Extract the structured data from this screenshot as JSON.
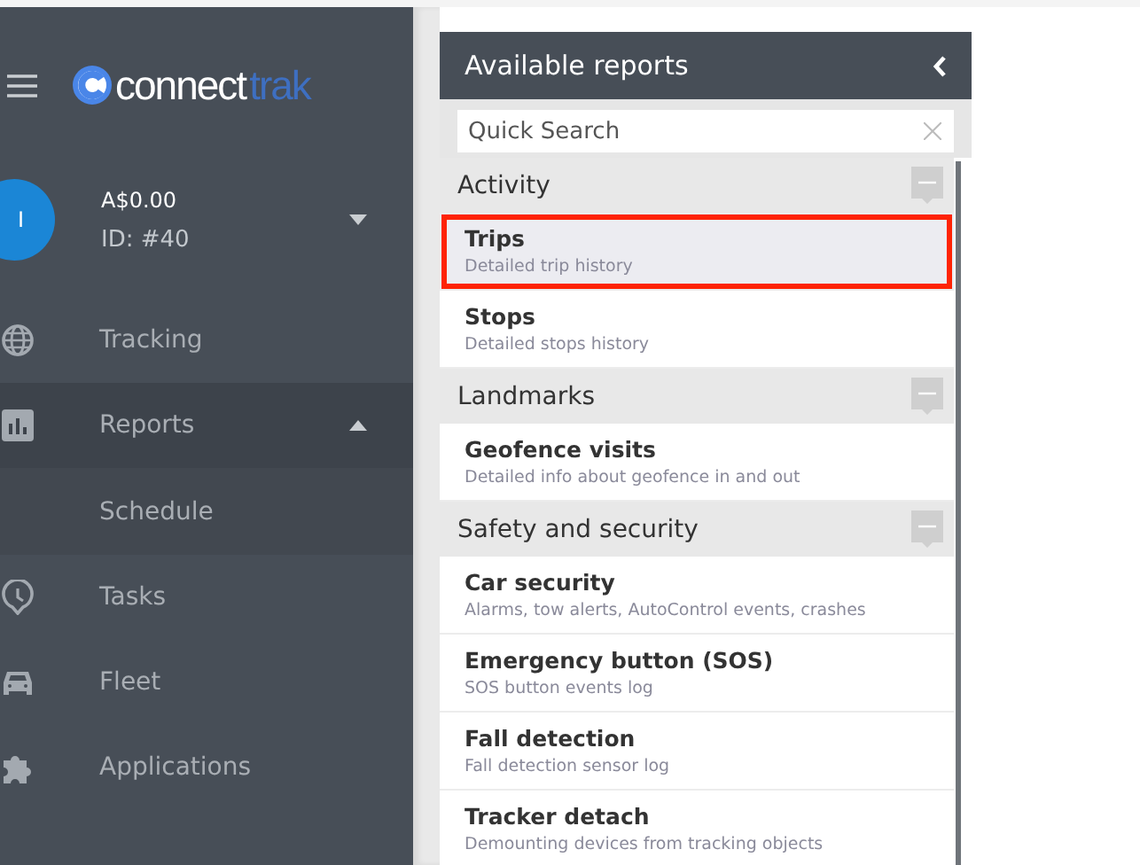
{
  "sidebar": {
    "logo": {
      "main": "connect",
      "accent": "trak"
    },
    "account": {
      "avatar_letter": "I",
      "balance": "A$0.00",
      "id": "ID: #40"
    },
    "items": [
      {
        "label": "Tracking",
        "selected": false
      },
      {
        "label": "Reports",
        "selected": true,
        "expanded": true,
        "children": [
          {
            "label": "Schedule",
            "selected": false
          }
        ]
      },
      {
        "label": "Tasks",
        "selected": false
      },
      {
        "label": "Fleet",
        "selected": false
      },
      {
        "label": "Applications",
        "selected": false
      }
    ]
  },
  "panel": {
    "title": "Available reports",
    "search": {
      "placeholder": "Quick Search"
    },
    "groups": [
      {
        "title": "Activity",
        "expanded": true,
        "items": [
          {
            "name": "Trips",
            "description": "Detailed trip history",
            "selected": true
          },
          {
            "name": "Stops",
            "description": "Detailed stops history",
            "selected": false
          }
        ]
      },
      {
        "title": "Landmarks",
        "expanded": true,
        "items": [
          {
            "name": "Geofence visits",
            "description": "Detailed info about geofence in and out",
            "selected": false
          }
        ]
      },
      {
        "title": "Safety and security",
        "expanded": true,
        "items": [
          {
            "name": "Car security",
            "description": "Alarms, tow alerts, AutoControl events, crashes",
            "selected": false
          },
          {
            "name": "Emergency button (SOS)",
            "description": "SOS button events log",
            "selected": false
          },
          {
            "name": "Fall detection",
            "description": "Fall detection sensor log",
            "selected": false
          },
          {
            "name": "Tracker detach",
            "description": "Demounting devices from tracking objects",
            "selected": false
          }
        ]
      }
    ]
  }
}
